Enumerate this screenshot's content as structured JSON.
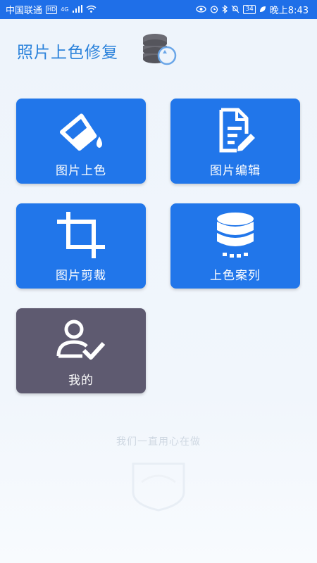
{
  "status_bar": {
    "carrier": "中国联通",
    "hd": "HD",
    "network": "4G",
    "battery": "34",
    "time": "晚上8:43"
  },
  "header": {
    "title": "照片上色修复",
    "icon": "database-restore-icon"
  },
  "tiles": [
    {
      "label": "图片上色",
      "icon": "paint-bucket-icon"
    },
    {
      "label": "图片编辑",
      "icon": "document-edit-icon"
    },
    {
      "label": "图片剪裁",
      "icon": "crop-icon"
    },
    {
      "label": "上色案列",
      "icon": "database-icon"
    },
    {
      "label": "我的",
      "icon": "user-check-icon"
    }
  ],
  "footer": {
    "text": "我们一直用心在做",
    "logo": "shield-logo-icon"
  },
  "colors": {
    "status_bar": "#1f6fe8",
    "tile_blue": "#2176ea",
    "tile_gray": "#5e5a70",
    "title": "#2b82db"
  }
}
